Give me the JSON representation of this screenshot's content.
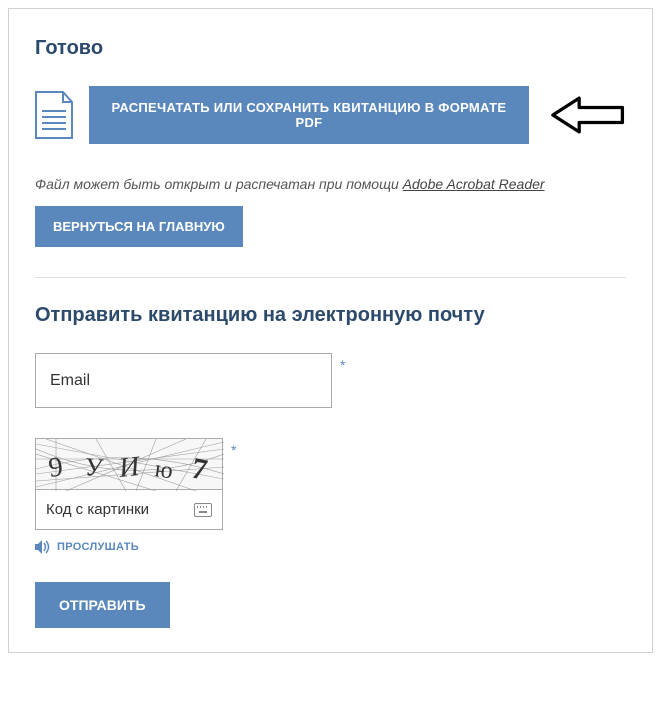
{
  "ready_title": "Готово",
  "print_button": "РАСПЕЧАТАТЬ ИЛИ СОХРАНИТЬ КВИТАНЦИЮ В ФОРМАТЕ PDF",
  "help_text_prefix": "Файл может быть открыт и распечатан при помощи ",
  "help_link": "Adobe Acrobat Reader",
  "home_button": "ВЕРНУТЬСЯ НА ГЛАВНУЮ",
  "send_title": "Отправить квитанцию на электронную почту",
  "email_placeholder": "Email",
  "required_mark": "*",
  "captcha_text": "9 У И ю 7",
  "captcha_placeholder": "Код с картинки",
  "listen_label": "ПРОСЛУШАТЬ",
  "submit_button": "ОТПРАВИТЬ"
}
